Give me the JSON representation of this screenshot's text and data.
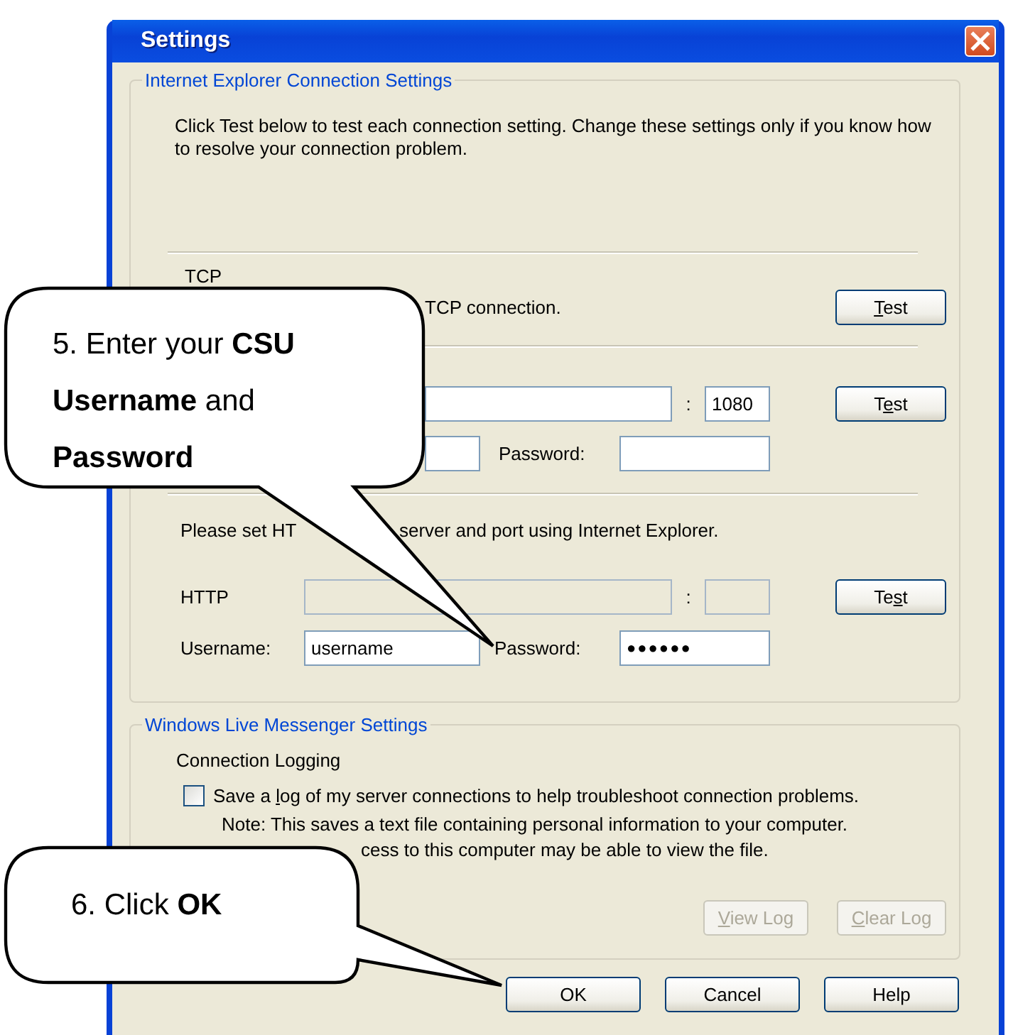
{
  "window": {
    "title": "Settings"
  },
  "ie_group": {
    "title": "Internet Explorer Connection Settings",
    "description": "Click Test below to test each connection setting. Change these settings only if you know how to resolve your connection problem.",
    "tcp": {
      "label": "TCP",
      "text": "TCP connection.",
      "test_button": {
        "access_key": "T",
        "after": "est"
      }
    },
    "proxy": {
      "port_separator": ":",
      "port": "1080",
      "password_label": "Password:",
      "test_button": {
        "before": "T",
        "access_key": "e",
        "after": "st"
      }
    },
    "http_note_start": "Please set HT",
    "http_note_end": "server and port using Internet Explorer.",
    "http": {
      "label": "HTTP",
      "disabled": true,
      "port_separator": ":",
      "username_label": "Username:",
      "username": "username",
      "password_label": "Password:",
      "password": "●●●●●●",
      "test_button": {
        "before": "Te",
        "access_key": "s",
        "after": "t"
      }
    }
  },
  "messenger_group": {
    "title": "Windows Live Messenger Settings",
    "subtitle": "Connection Logging",
    "checkbox": {
      "before": "Save a ",
      "access_key": "l",
      "after": "og of my server connections to help troubleshoot connection problems.",
      "checked": false
    },
    "note_line_1": "Note: This saves a text file containing personal information to your computer.",
    "note_line_2": "cess to this computer may be able to view the file.",
    "buttons": [
      {
        "access_key": "V",
        "after": "iew Log",
        "disabled": true
      },
      {
        "access_key": "C",
        "after": "lear Log",
        "disabled": true
      }
    ]
  },
  "dialog_buttons": [
    {
      "label": "OK"
    },
    {
      "label": "Cancel"
    },
    {
      "label": "Help"
    }
  ],
  "callouts": [
    {
      "text": "5. Enter your **CSU Username** and **Password**"
    },
    {
      "text": "6. Click **OK**"
    }
  ]
}
